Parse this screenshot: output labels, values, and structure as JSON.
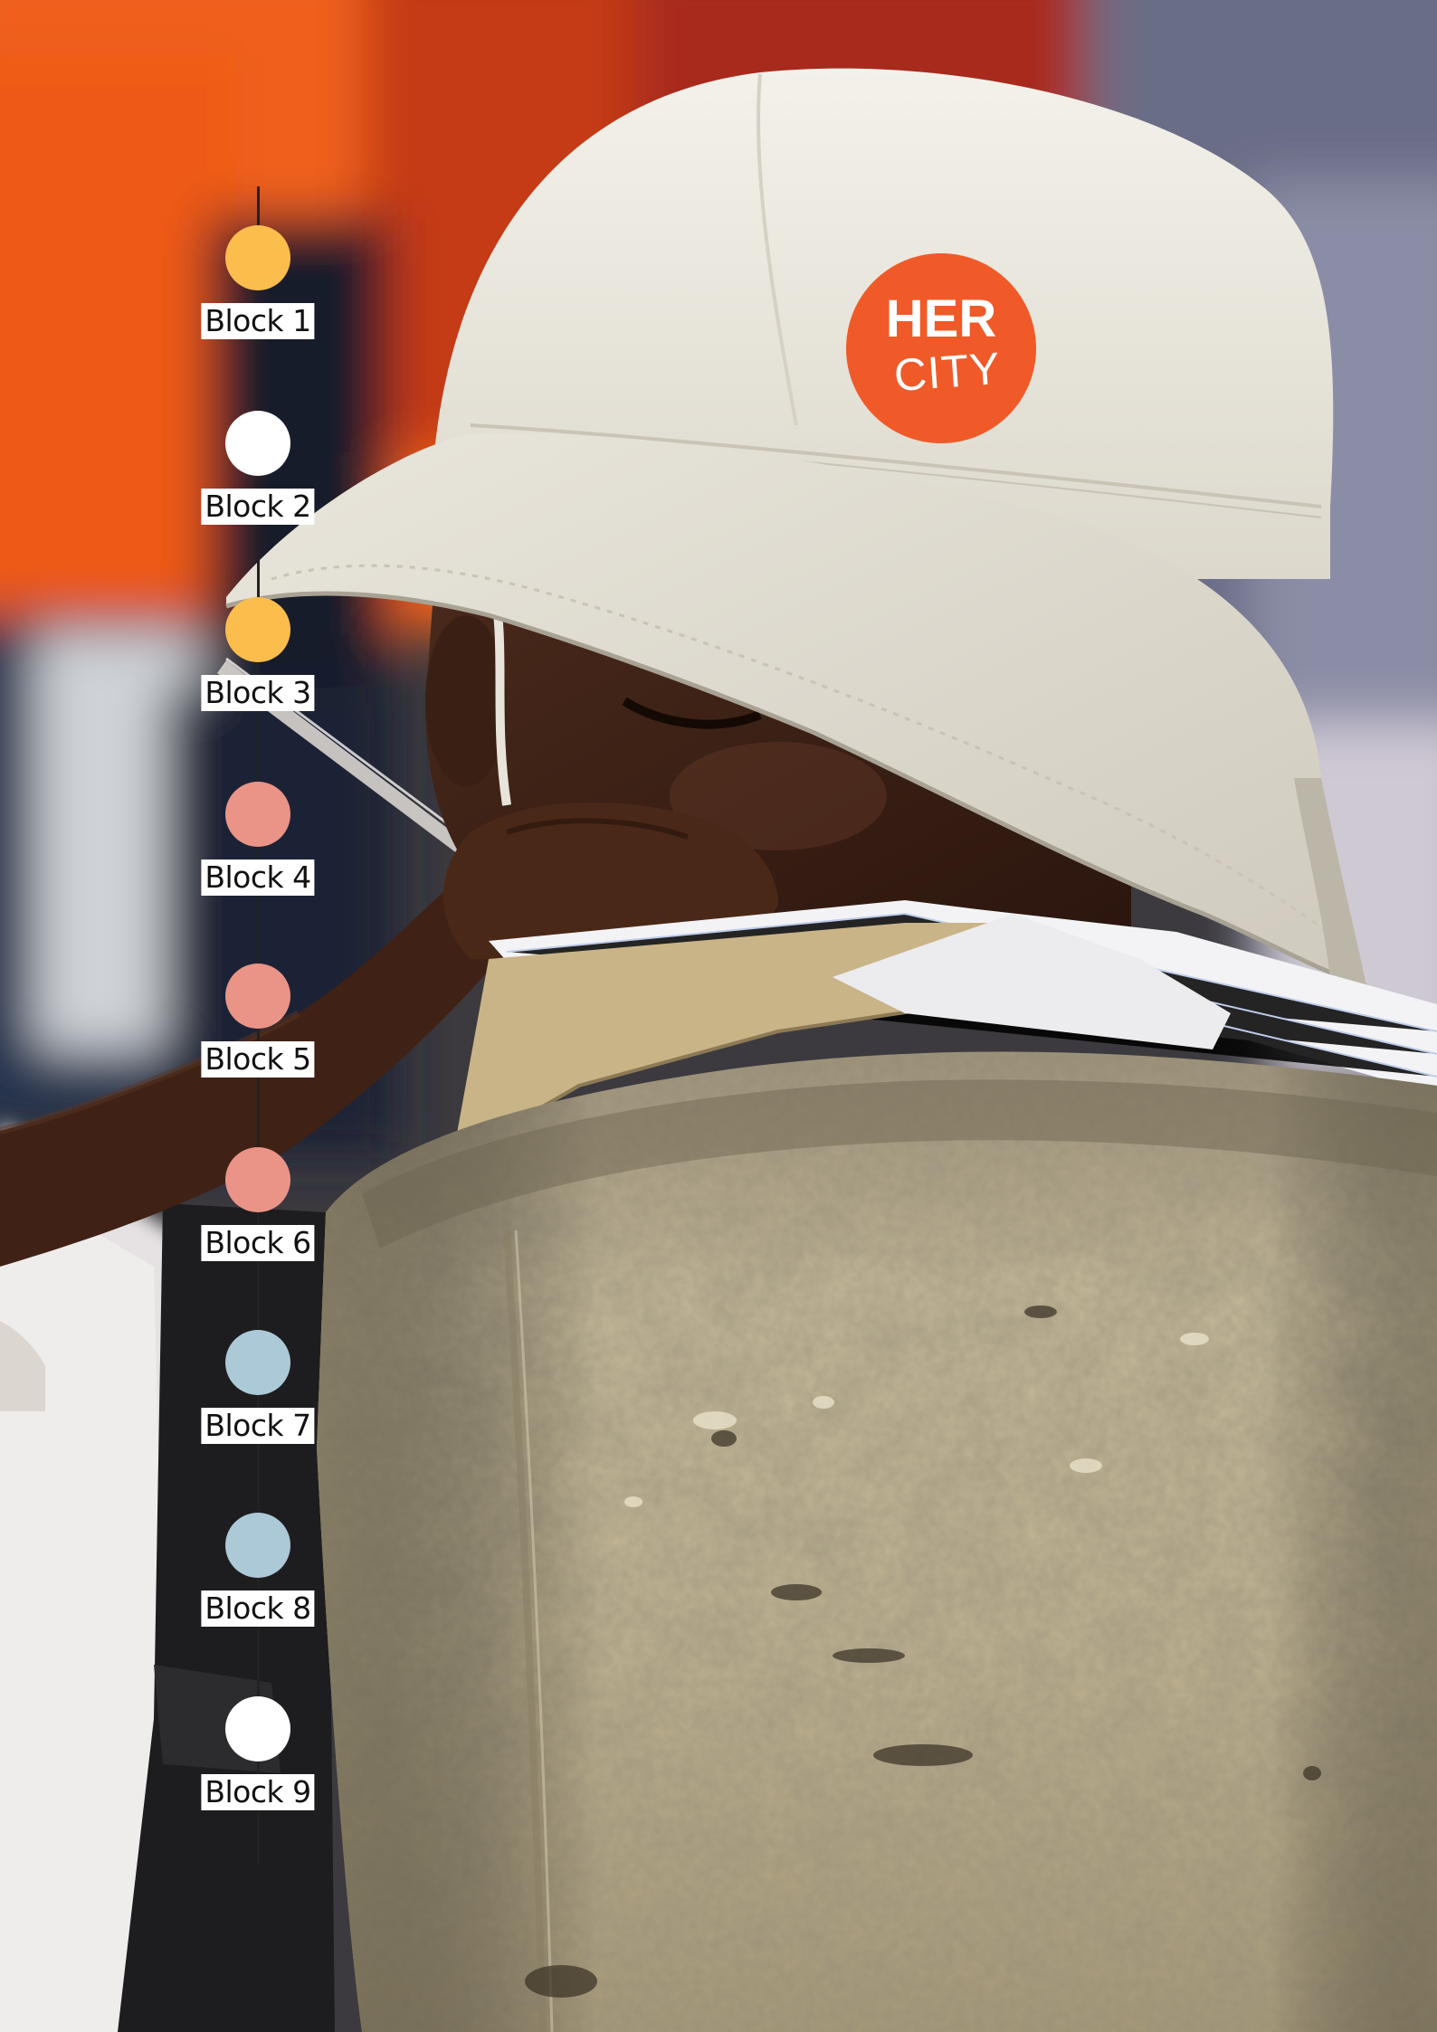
{
  "hat_badge": {
    "line1": "HER",
    "line2": "CITY",
    "color": "#f05a28"
  },
  "timeline": {
    "line_color": "#222222",
    "blocks": [
      {
        "label": "Block 1",
        "color": "#fbbd4c"
      },
      {
        "label": "Block 2",
        "color": "#ffffff"
      },
      {
        "label": "Block 3",
        "color": "#fbbd4c"
      },
      {
        "label": "Block 4",
        "color": "#e99487"
      },
      {
        "label": "Block 5",
        "color": "#e99487"
      },
      {
        "label": "Block 6",
        "color": "#e99487"
      },
      {
        "label": "Block 7",
        "color": "#acc9d7"
      },
      {
        "label": "Block 8",
        "color": "#acc9d7"
      },
      {
        "label": "Block 9",
        "color": "#ffffff"
      }
    ]
  }
}
